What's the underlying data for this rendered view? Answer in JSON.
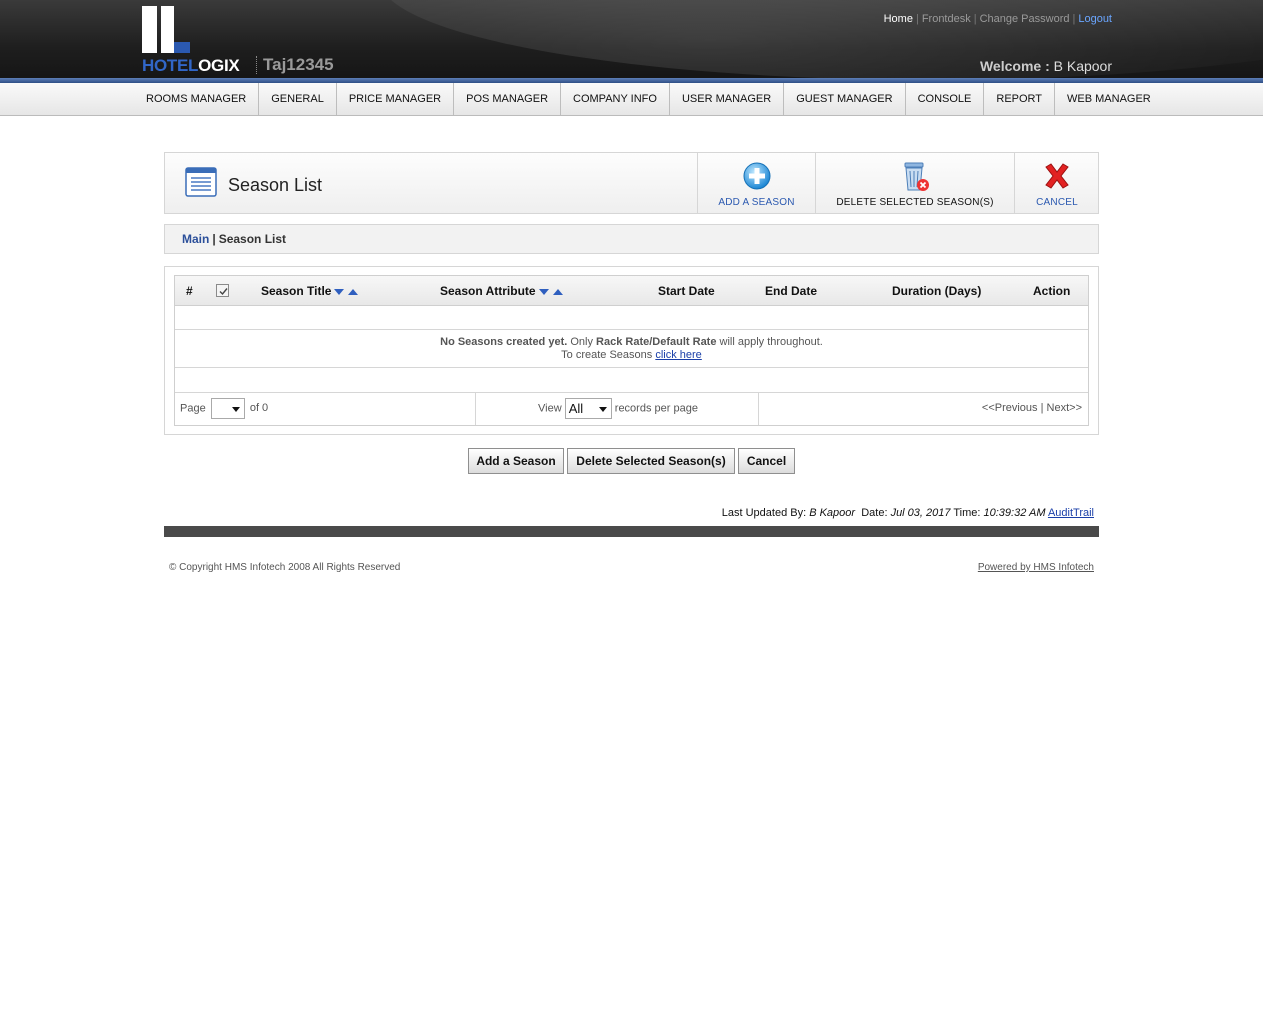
{
  "header": {
    "brand_left": "HOTEL",
    "brand_right": "OGIX",
    "property_code": "Taj12345",
    "links": [
      "Home",
      "Frontdesk",
      "Change Password",
      "Logout"
    ],
    "welcome_label": "Welcome :",
    "user_name": "B Kapoor"
  },
  "nav": {
    "items": [
      "ROOMS MANAGER",
      "GENERAL",
      "PRICE MANAGER",
      "POS MANAGER",
      "COMPANY INFO",
      "USER MANAGER",
      "GUEST MANAGER",
      "CONSOLE",
      "REPORT",
      "WEB MANAGER"
    ]
  },
  "title_panel": {
    "title": "Season List",
    "add_label": "ADD A SEASON",
    "delete_label": "DELETE SELECTED SEASON(S)",
    "cancel_label": "CANCEL"
  },
  "breadcrumb": {
    "main": "Main",
    "separator": "|",
    "current": "Season List"
  },
  "table": {
    "columns": {
      "num": "#",
      "title": "Season Title",
      "attribute": "Season Attribute",
      "start": "Start Date",
      "end": "End Date",
      "duration": "Duration (Days)",
      "action": "Action"
    },
    "select_all_checked": true,
    "empty": {
      "bold1": "No Seasons created yet.",
      "text1": " Only ",
      "bold2": "Rack Rate/Default Rate",
      "text2": " will apply throughout.",
      "text3": "To create Seasons ",
      "link": "click here"
    },
    "pager": {
      "page_label": "Page",
      "page_value": "",
      "of_label": "of 0",
      "view_label": "View",
      "view_value": "All",
      "per_page_label": "records per page",
      "prev": "<<Previous",
      "sep": "|",
      "next": "Next>>"
    }
  },
  "buttons": {
    "add": "Add a Season",
    "delete": "Delete Selected Season(s)",
    "cancel": "Cancel"
  },
  "last_updated": {
    "by_label": "Last Updated By:",
    "by_value": "B Kapoor",
    "date_label": "Date:",
    "date_value": "Jul 03, 2017",
    "time_label": "Time:",
    "time_value": "10:39:32 AM",
    "audit_link": "AuditTrail"
  },
  "footer": {
    "copyright": "© Copyright HMS Infotech 2008 All Rights Reserved",
    "powered": "Powered by HMS Infotech"
  },
  "colors": {
    "brand_blue": "#2b59b0",
    "link_blue": "#1a3fa8",
    "header_dark": "#1e1e1e"
  }
}
